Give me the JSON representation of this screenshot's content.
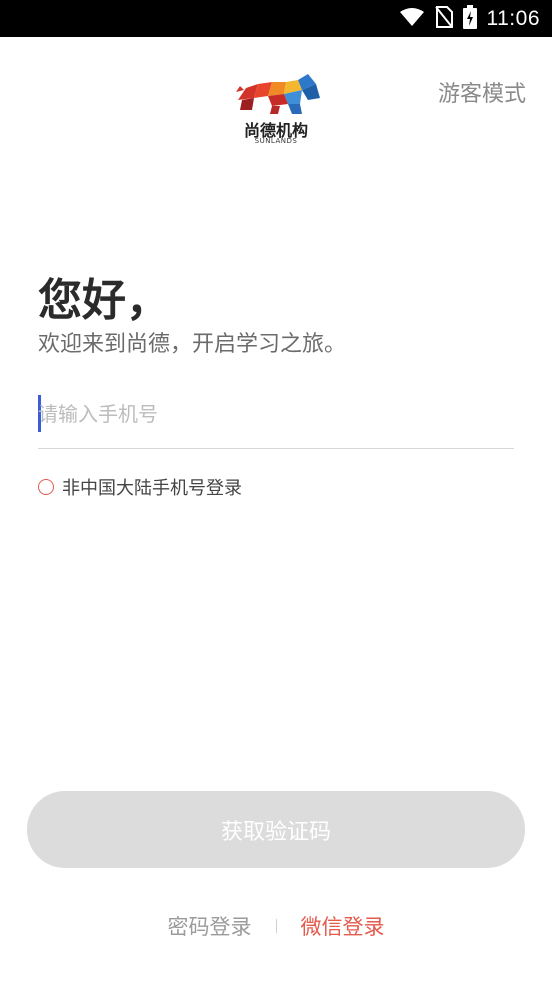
{
  "status_bar": {
    "time": "11:06",
    "icons": [
      "wifi-icon",
      "no-sim-icon",
      "battery-charging-icon"
    ]
  },
  "header": {
    "logo_name": "尚德机构",
    "logo_sub": "SUNLANDS",
    "guest_mode": "游客模式"
  },
  "greeting": {
    "title": "您好，",
    "subtitle": "欢迎来到尚德，开启学习之旅。"
  },
  "phone": {
    "value": "",
    "placeholder": "请输入手机号"
  },
  "non_mainland": {
    "label": "非中国大陆手机号登录"
  },
  "get_code": {
    "label": "获取验证码"
  },
  "alt_login": {
    "password": "密码登录",
    "wechat": "微信登录"
  },
  "colors": {
    "accent": "#e45a4d",
    "caret": "#3b5bdb",
    "button_disabled": "#dcdcdc"
  }
}
